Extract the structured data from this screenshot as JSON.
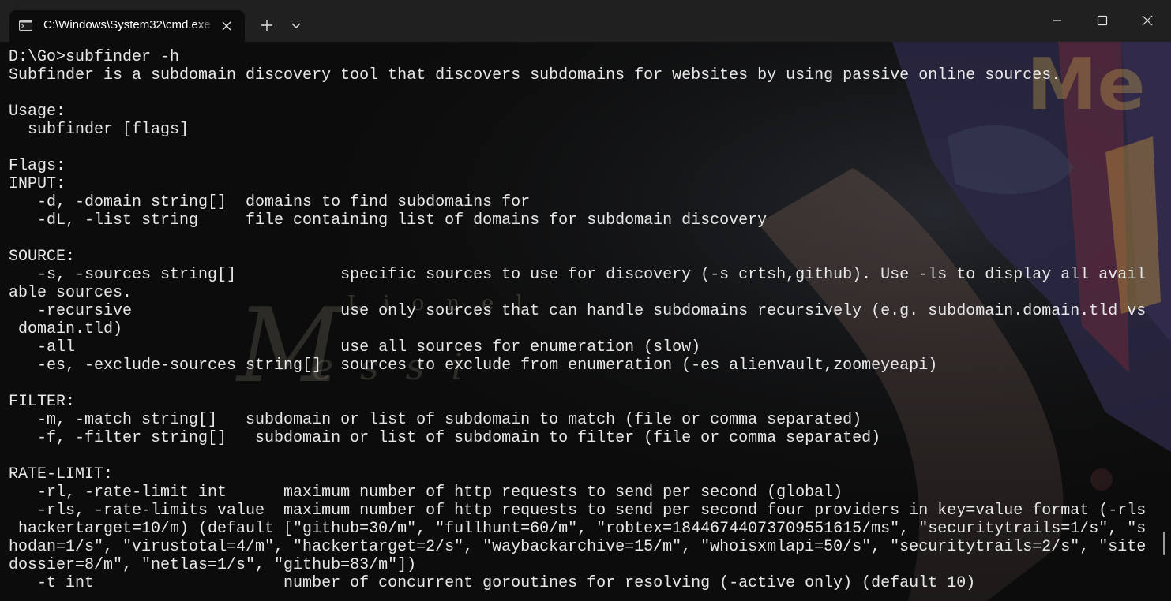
{
  "window": {
    "tab_title": "C:\\Windows\\System32\\cmd.exe",
    "icons": {
      "tab_icon": "console-icon",
      "close_tab": "close-icon",
      "new_tab": "plus-icon",
      "dropdown": "chevron-down-icon",
      "minimize": "minimize-icon",
      "maximize": "maximize-icon",
      "close_window": "close-icon"
    },
    "colors": {
      "titlebar": "#202020",
      "terminal_bg": "#0c0c0c",
      "text": "#e8e8e8"
    }
  },
  "terminal": {
    "lines": [
      "D:\\Go>subfinder -h",
      "Subfinder is a subdomain discovery tool that discovers subdomains for websites by using passive online sources.",
      "",
      "Usage:",
      "  subfinder [flags]",
      "",
      "Flags:",
      "INPUT:",
      "   -d, -domain string[]  domains to find subdomains for",
      "   -dL, -list string     file containing list of domains for subdomain discovery",
      "",
      "SOURCE:",
      "   -s, -sources string[]           specific sources to use for discovery (-s crtsh,github). Use -ls to display all avail",
      "able sources.",
      "   -recursive                      use only sources that can handle subdomains recursively (e.g. subdomain.domain.tld vs",
      " domain.tld)",
      "   -all                            use all sources for enumeration (slow)",
      "   -es, -exclude-sources string[]  sources to exclude from enumeration (-es alienvault,zoomeyeapi)",
      "",
      "FILTER:",
      "   -m, -match string[]   subdomain or list of subdomain to match (file or comma separated)",
      "   -f, -filter string[]   subdomain or list of subdomain to filter (file or comma separated)",
      "",
      "RATE-LIMIT:",
      "   -rl, -rate-limit int      maximum number of http requests to send per second (global)",
      "   -rls, -rate-limits value  maximum number of http requests to send per second four providers in key=value format (-rls",
      " hackertarget=10/m) (default [\"github=30/m\", \"fullhunt=60/m\", \"robtex=18446744073709551615/ms\", \"securitytrails=1/s\", \"s",
      "hodan=1/s\", \"virustotal=4/m\", \"hackertarget=2/s\", \"waybackarchive=15/m\", \"whoisxmlapi=50/s\", \"securitytrails=2/s\", \"site",
      "dossier=8/m\", \"netlas=1/s\", \"github=83/m\"])",
      "   -t int                    number of concurrent goroutines for resolving (-active only) (default 10)"
    ]
  }
}
